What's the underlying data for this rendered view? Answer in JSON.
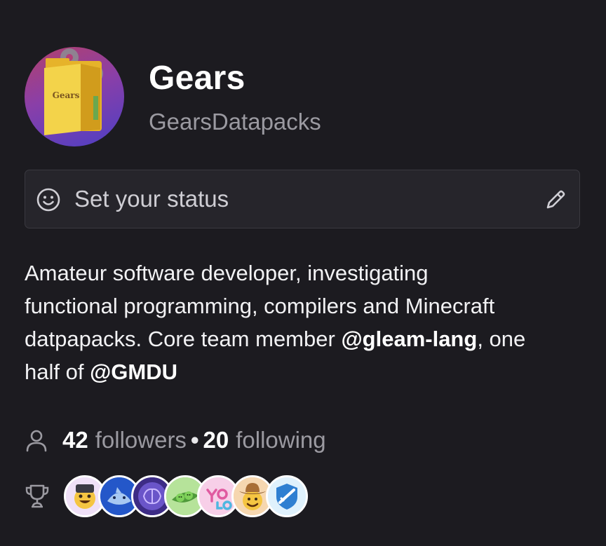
{
  "profile": {
    "display_name": "Gears",
    "username": "GearsDatapacks",
    "avatar_text": "Gears",
    "avatar_icon": "folder-with-gears-avatar"
  },
  "status": {
    "placeholder": "Set your status",
    "leading_icon": "smiley-icon",
    "trailing_icon": "pencil-icon"
  },
  "bio": {
    "line1": "Amateur software developer, investigating",
    "line2": "functional programming, compilers and Minecraft",
    "line3_prefix": "datpapacks. Core team member ",
    "mention1": "@gleam-lang",
    "line3_suffix": ", one",
    "line4_prefix": "half of ",
    "mention2": "@GMDU"
  },
  "follow": {
    "icon": "person-icon",
    "followers_count": "42",
    "followers_label": "followers",
    "separator": "•",
    "following_count": "20",
    "following_label": "following"
  },
  "achievements": {
    "icon": "trophy-icon",
    "badges": [
      "pull-shark-badge",
      "shark-badge",
      "galaxy-brain-badge",
      "pair-extraordinaire-badge",
      "yolo-badge",
      "quickdraw-badge",
      "arctic-code-vault-badge"
    ]
  },
  "colors": {
    "background": "#1c1b20",
    "status_box": "#26252b",
    "muted_text": "#9b9aa1",
    "primary_text": "#ffffff"
  }
}
